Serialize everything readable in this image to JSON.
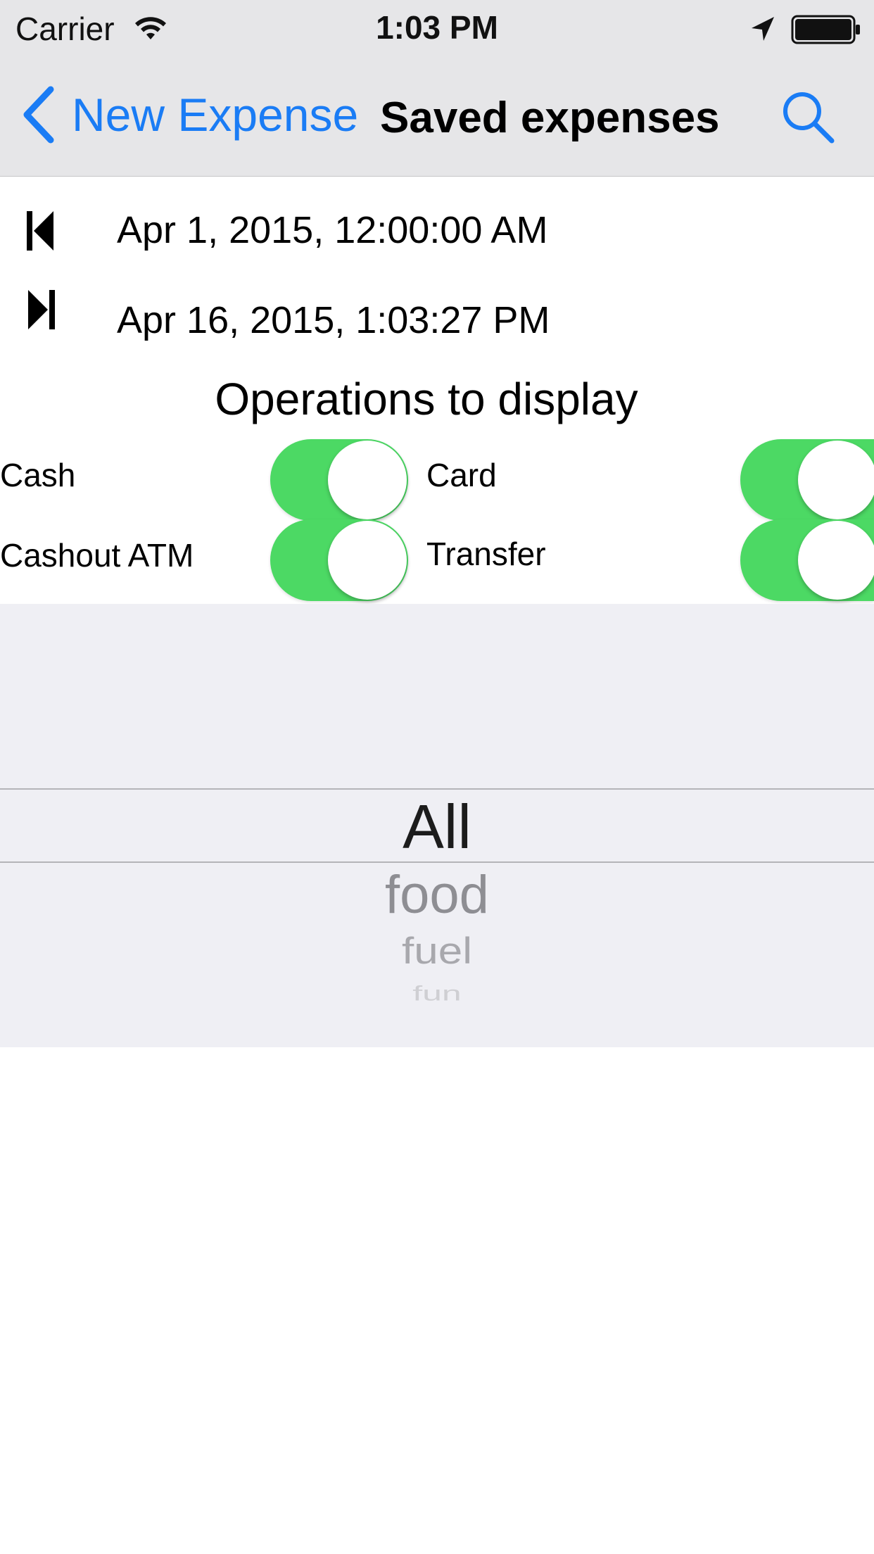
{
  "status_bar": {
    "carrier": "Carrier",
    "time": "1:03 PM"
  },
  "nav": {
    "back_label": "New Expense",
    "title": "Saved expenses",
    "search_icon": "search-icon",
    "accent_color": "#1a7cf5"
  },
  "dates": {
    "start": "Apr 1, 2015, 12:00:00 AM",
    "end": "Apr 16, 2015, 1:03:27 PM"
  },
  "operations": {
    "title": "Operations to display",
    "toggles": [
      {
        "label": "Cash",
        "on": true
      },
      {
        "label": "Card",
        "on": true
      },
      {
        "label": "Cashout ATM",
        "on": true
      },
      {
        "label": "Transfer",
        "on": true
      }
    ],
    "toggle_color": "#4cd964"
  },
  "picker": {
    "selected": "All",
    "items": [
      "food",
      "fuel",
      "fun"
    ]
  }
}
